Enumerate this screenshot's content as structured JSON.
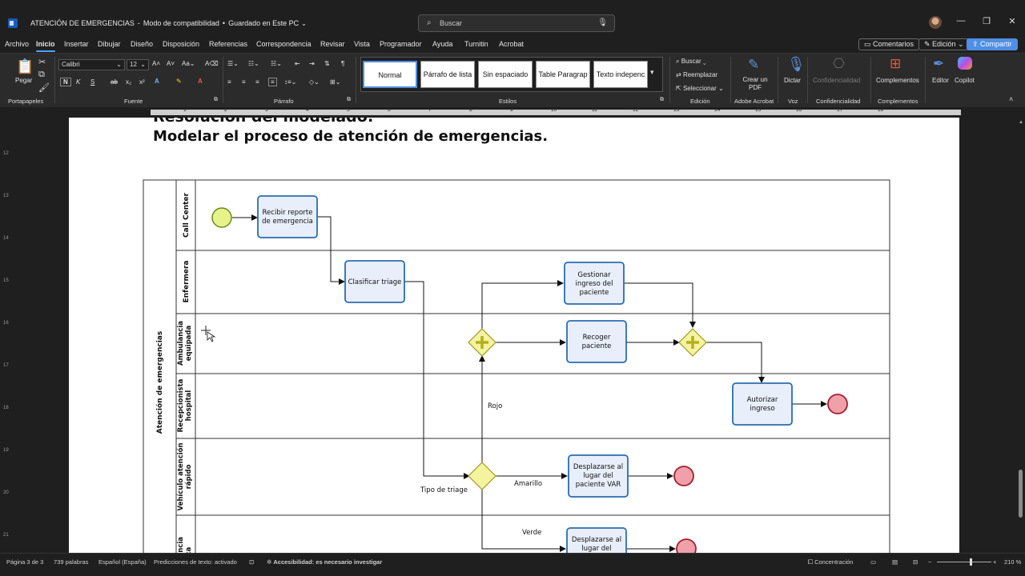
{
  "titlebar": {
    "doc_name": "ATENCIÓN DE EMERGENCIAS",
    "mode": "Modo de compatibilidad",
    "save_state": "Guardado en Este PC",
    "search_placeholder": "Buscar"
  },
  "menu": {
    "items": [
      "Archivo",
      "Inicio",
      "Insertar",
      "Dibujar",
      "Diseño",
      "Disposición",
      "Referencias",
      "Correspondencia",
      "Revisar",
      "Vista",
      "Programador",
      "Ayuda",
      "Turnitin",
      "Acrobat"
    ],
    "active": "Inicio",
    "comments": "Comentarios",
    "editing": "Edición",
    "share": "Compartir"
  },
  "ribbon": {
    "clipboard": {
      "paste": "Pegar",
      "label": "Portapapeles"
    },
    "font": {
      "name": "Calibri",
      "size": "12",
      "label": "Fuente"
    },
    "paragraph": {
      "label": "Párrafo"
    },
    "styles": {
      "items": [
        "Normal",
        "Párrafo de lista",
        "Sin espaciado",
        "Table Paragrap",
        "Texto indepenc"
      ],
      "selected": "Normal",
      "label": "Estilos"
    },
    "editing": {
      "find": "Buscar",
      "replace": "Reemplazar",
      "select": "Seleccionar",
      "label": "Edición"
    },
    "acrobat": {
      "button": "Crear un PDF",
      "label": "Adobe Acrobat"
    },
    "voice": {
      "button": "Dictar",
      "label": "Voz"
    },
    "confidentiality": {
      "button": "Confidencialidad",
      "label": "Confidencialidad"
    },
    "addins": {
      "button": "Complementos",
      "label": "Complementos"
    },
    "editor": "Editor",
    "copilot": "Copilot"
  },
  "ruler": {
    "horizontal_numbers": [
      "1",
      "2",
      "3",
      "4",
      "5",
      "6",
      "7",
      "8",
      "9",
      "10",
      "11",
      "12",
      "13",
      "14",
      "15",
      "16",
      "17",
      "18"
    ],
    "vertical_numbers": [
      "12",
      "13",
      "14",
      "15",
      "16",
      "17",
      "18",
      "19",
      "20",
      "21"
    ]
  },
  "document": {
    "heading_partial": "Resolución del modelado:",
    "heading": "Modelar el proceso de atención de emergencias.",
    "diagram": {
      "pool": "Atención de emergencias",
      "lanes": [
        "Call Center",
        "Enfermera",
        "Ambulancia equipada",
        "Recepcionista hospital",
        "Vehículo atención rápido",
        "Ambulancia básica"
      ],
      "tasks": {
        "recibir": "Recibir reporte de emergencia",
        "clasificar": "Clasificar triage",
        "gestionar": "Gestionar ingreso del paciente",
        "recoger": "Recoger paciente",
        "autorizar": "Autorizar ingreso",
        "desplazarse_var": "Desplazarse al lugar del paciente VAR",
        "desplazarse_tab": "Desplazarse al lugar del"
      },
      "labels": {
        "gateway": "Tipo de triage",
        "rojo": "Rojo",
        "amarillo": "Amarillo",
        "verde": "Verde"
      }
    }
  },
  "status": {
    "page": "Página 3 de 3",
    "words": "739 palabras",
    "language": "Español (España)",
    "predictions": "Predicciones de texto: activado",
    "accessibility": "Accesibilidad: es necesario investigar",
    "focus": "Concentración",
    "zoom": "210 %",
    "zoom_fraction": 0.6
  },
  "colors": {
    "accent": "#4f8fe6",
    "task_fill": "#e8eefa",
    "task_stroke": "#2a6db0",
    "start_fill": "#e6f28a",
    "end_fill": "#f0a0a8",
    "gateway_fill": "#f5f3a0"
  }
}
